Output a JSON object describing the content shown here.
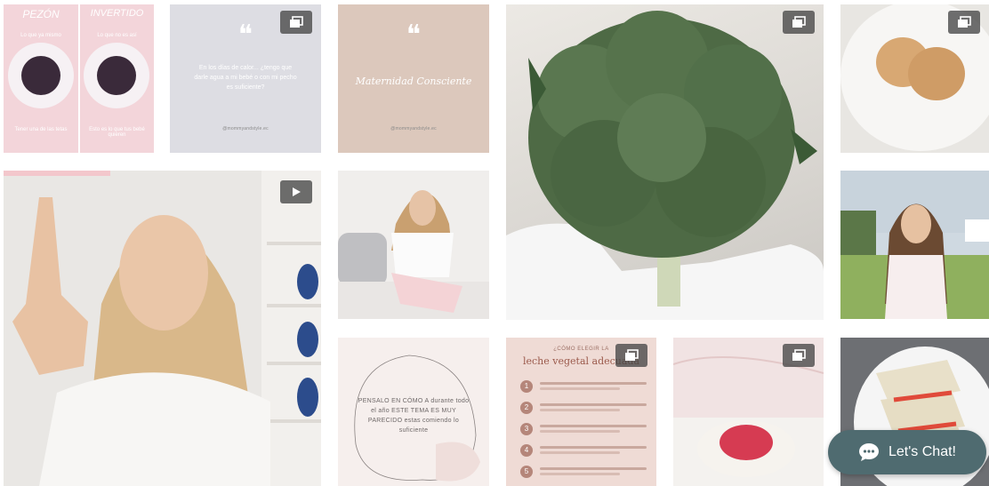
{
  "posts": {
    "eye": {
      "top_left": "PEZÓN",
      "top_right": "INVERTIDO",
      "sub_left": "Lo que ya mismo",
      "sub_right": "Lo que no es así",
      "bottom_left": "Tener una de las tetas",
      "bottom_right": "Esto es lo que tus bebé quieren"
    },
    "water": {
      "text": "En los días de calor... ¿tengo que darle agua a mi bebé o con mi pecho es suficiente?",
      "handle": "@mommyandstyle.ec"
    },
    "maternidad": {
      "text": "Maternidad Consciente",
      "handle": "@mommyandstyle.ec"
    },
    "evolution": {
      "text": "PENSALO EN CÓMO A durante todo el año ESTE TEMA ES MUY PARECIDO estas comiendo lo suficiente"
    },
    "milk": {
      "title_small": "¿CÓMO ELEGIR LA",
      "title": "leche vegetal adecuada"
    }
  },
  "chat": {
    "label": "Let's Chat!",
    "icon": "chat-bubble-icon"
  },
  "colors": {
    "chat": "#4f6b70",
    "badge": "#464646"
  }
}
